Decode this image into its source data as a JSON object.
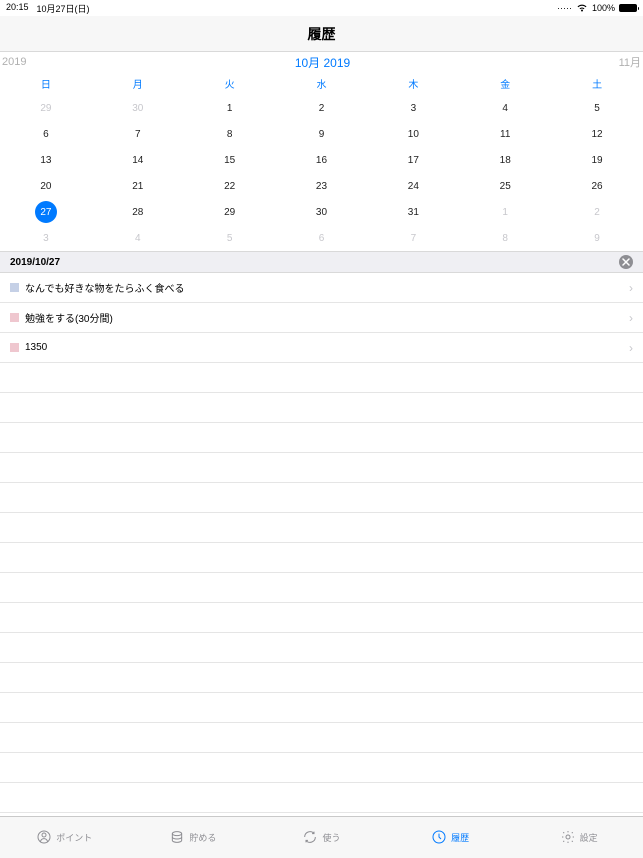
{
  "status_bar": {
    "time": "20:15",
    "date": "10月27日(日)",
    "battery": "100%"
  },
  "nav": {
    "title": "履歴"
  },
  "month_header": {
    "prev": "2019",
    "current": "10月 2019",
    "next": "11月"
  },
  "weekdays": [
    "日",
    "月",
    "火",
    "水",
    "木",
    "金",
    "土"
  ],
  "days": [
    {
      "d": "29",
      "other": true
    },
    {
      "d": "30",
      "other": true
    },
    {
      "d": "1"
    },
    {
      "d": "2"
    },
    {
      "d": "3"
    },
    {
      "d": "4"
    },
    {
      "d": "5"
    },
    {
      "d": "6"
    },
    {
      "d": "7"
    },
    {
      "d": "8"
    },
    {
      "d": "9"
    },
    {
      "d": "10"
    },
    {
      "d": "11"
    },
    {
      "d": "12"
    },
    {
      "d": "13"
    },
    {
      "d": "14"
    },
    {
      "d": "15"
    },
    {
      "d": "16"
    },
    {
      "d": "17"
    },
    {
      "d": "18"
    },
    {
      "d": "19"
    },
    {
      "d": "20"
    },
    {
      "d": "21"
    },
    {
      "d": "22"
    },
    {
      "d": "23"
    },
    {
      "d": "24"
    },
    {
      "d": "25"
    },
    {
      "d": "26"
    },
    {
      "d": "27",
      "selected": true
    },
    {
      "d": "28"
    },
    {
      "d": "29"
    },
    {
      "d": "30"
    },
    {
      "d": "31"
    },
    {
      "d": "1",
      "other": true
    },
    {
      "d": "2",
      "other": true
    },
    {
      "d": "3",
      "other": true
    },
    {
      "d": "4",
      "other": true
    },
    {
      "d": "5",
      "other": true
    },
    {
      "d": "6",
      "other": true
    },
    {
      "d": "7",
      "other": true
    },
    {
      "d": "8",
      "other": true
    },
    {
      "d": "9",
      "other": true
    }
  ],
  "section": {
    "date": "2019/10/27"
  },
  "items": [
    {
      "color": "#c5d0e6",
      "label": "なんでも好きな物をたらふく食べる"
    },
    {
      "color": "#efc7cf",
      "label": "勉強をする(30分間)"
    },
    {
      "color": "#efc7cf",
      "label": "1350"
    }
  ],
  "tabs": [
    {
      "icon": "points",
      "label": "ポイント"
    },
    {
      "icon": "save",
      "label": "貯める"
    },
    {
      "icon": "use",
      "label": "使う"
    },
    {
      "icon": "history",
      "label": "履歴",
      "active": true
    },
    {
      "icon": "settings",
      "label": "設定"
    }
  ]
}
